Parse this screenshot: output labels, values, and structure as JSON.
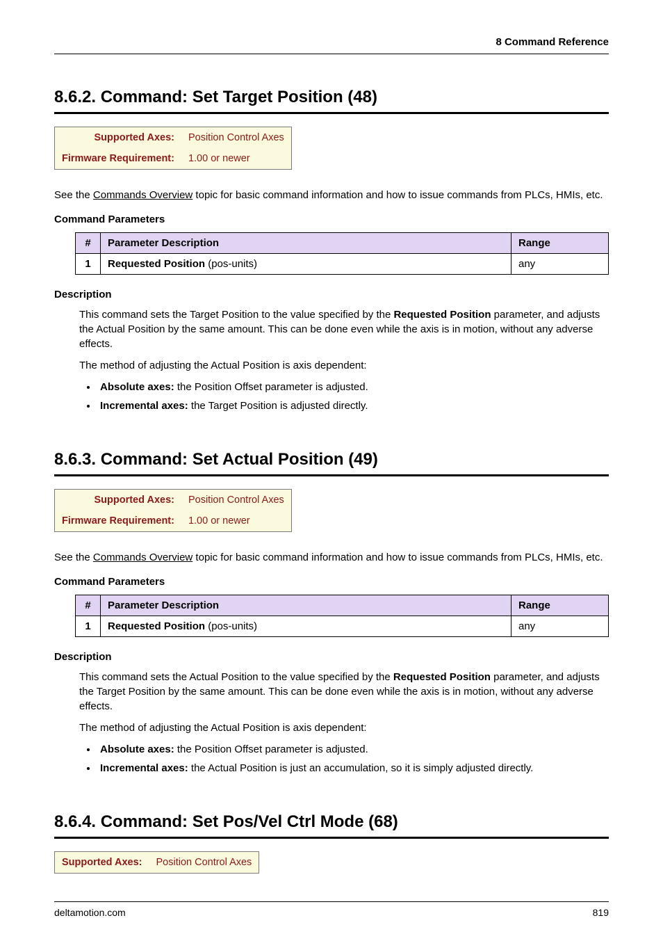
{
  "header": {
    "right": "8  Command Reference"
  },
  "sections": [
    {
      "heading": "8.6.2. Command: Set Target Position (48)",
      "info": {
        "axes_label": "Supported Axes:",
        "axes_value": "Position Control Axes",
        "fw_label": "Firmware Requirement:",
        "fw_value": "1.00 or newer"
      },
      "intro_prefix": "See the ",
      "intro_link": "Commands Overview",
      "intro_suffix": " topic for basic command information and how to issue commands from PLCs, HMIs, etc.",
      "params_heading": "Command Parameters",
      "params": {
        "h_num": "#",
        "h_desc": "Parameter Description",
        "h_range": "Range",
        "rows": [
          {
            "num": "1",
            "desc_bold": "Requested Position",
            "desc_rest": "  (pos-units)",
            "range": "any"
          }
        ]
      },
      "desc_heading": "Description",
      "desc_p1a": "This command sets the Target Position to the value specified by the ",
      "desc_p1b": "Requested Position",
      "desc_p1c": " parameter, and adjusts the Actual Position by the same amount. This can be done even while the axis is in motion, without any adverse effects.",
      "desc_p2": "The method of adjusting the Actual Position is axis dependent:",
      "bullets": [
        {
          "bold": "Absolute axes:",
          "rest": " the Position Offset parameter is adjusted."
        },
        {
          "bold": "Incremental axes:",
          "rest": " the Target Position is adjusted directly."
        }
      ]
    },
    {
      "heading": "8.6.3. Command: Set Actual Position (49)",
      "info": {
        "axes_label": "Supported Axes:",
        "axes_value": "Position Control Axes",
        "fw_label": "Firmware Requirement:",
        "fw_value": "1.00 or newer"
      },
      "intro_prefix": "See the ",
      "intro_link": "Commands Overview",
      "intro_suffix": " topic for basic command information and how to issue commands from PLCs, HMIs, etc.",
      "params_heading": "Command Parameters",
      "params": {
        "h_num": "#",
        "h_desc": "Parameter Description",
        "h_range": "Range",
        "rows": [
          {
            "num": "1",
            "desc_bold": "Requested Position",
            "desc_rest": "  (pos-units)",
            "range": "any"
          }
        ]
      },
      "desc_heading": "Description",
      "desc_p1a": "This command sets the Actual Position to the value specified by the ",
      "desc_p1b": "Requested Position",
      "desc_p1c": " parameter, and adjusts the Target Position by the same amount. This can be done even while the axis is in motion, without any adverse effects.",
      "desc_p2": "The method of adjusting the Actual Position is axis dependent:",
      "bullets": [
        {
          "bold": "Absolute axes:",
          "rest": " the Position Offset parameter is adjusted."
        },
        {
          "bold": "Incremental axes:",
          "rest": " the Actual Position is just an accumulation, so it is simply adjusted directly."
        }
      ]
    },
    {
      "heading": "8.6.4. Command: Set Pos/Vel Ctrl Mode (68)",
      "info": {
        "axes_label": "Supported Axes:",
        "axes_value": "Position Control Axes"
      }
    }
  ],
  "footer": {
    "left": "deltamotion.com",
    "right": "819"
  }
}
